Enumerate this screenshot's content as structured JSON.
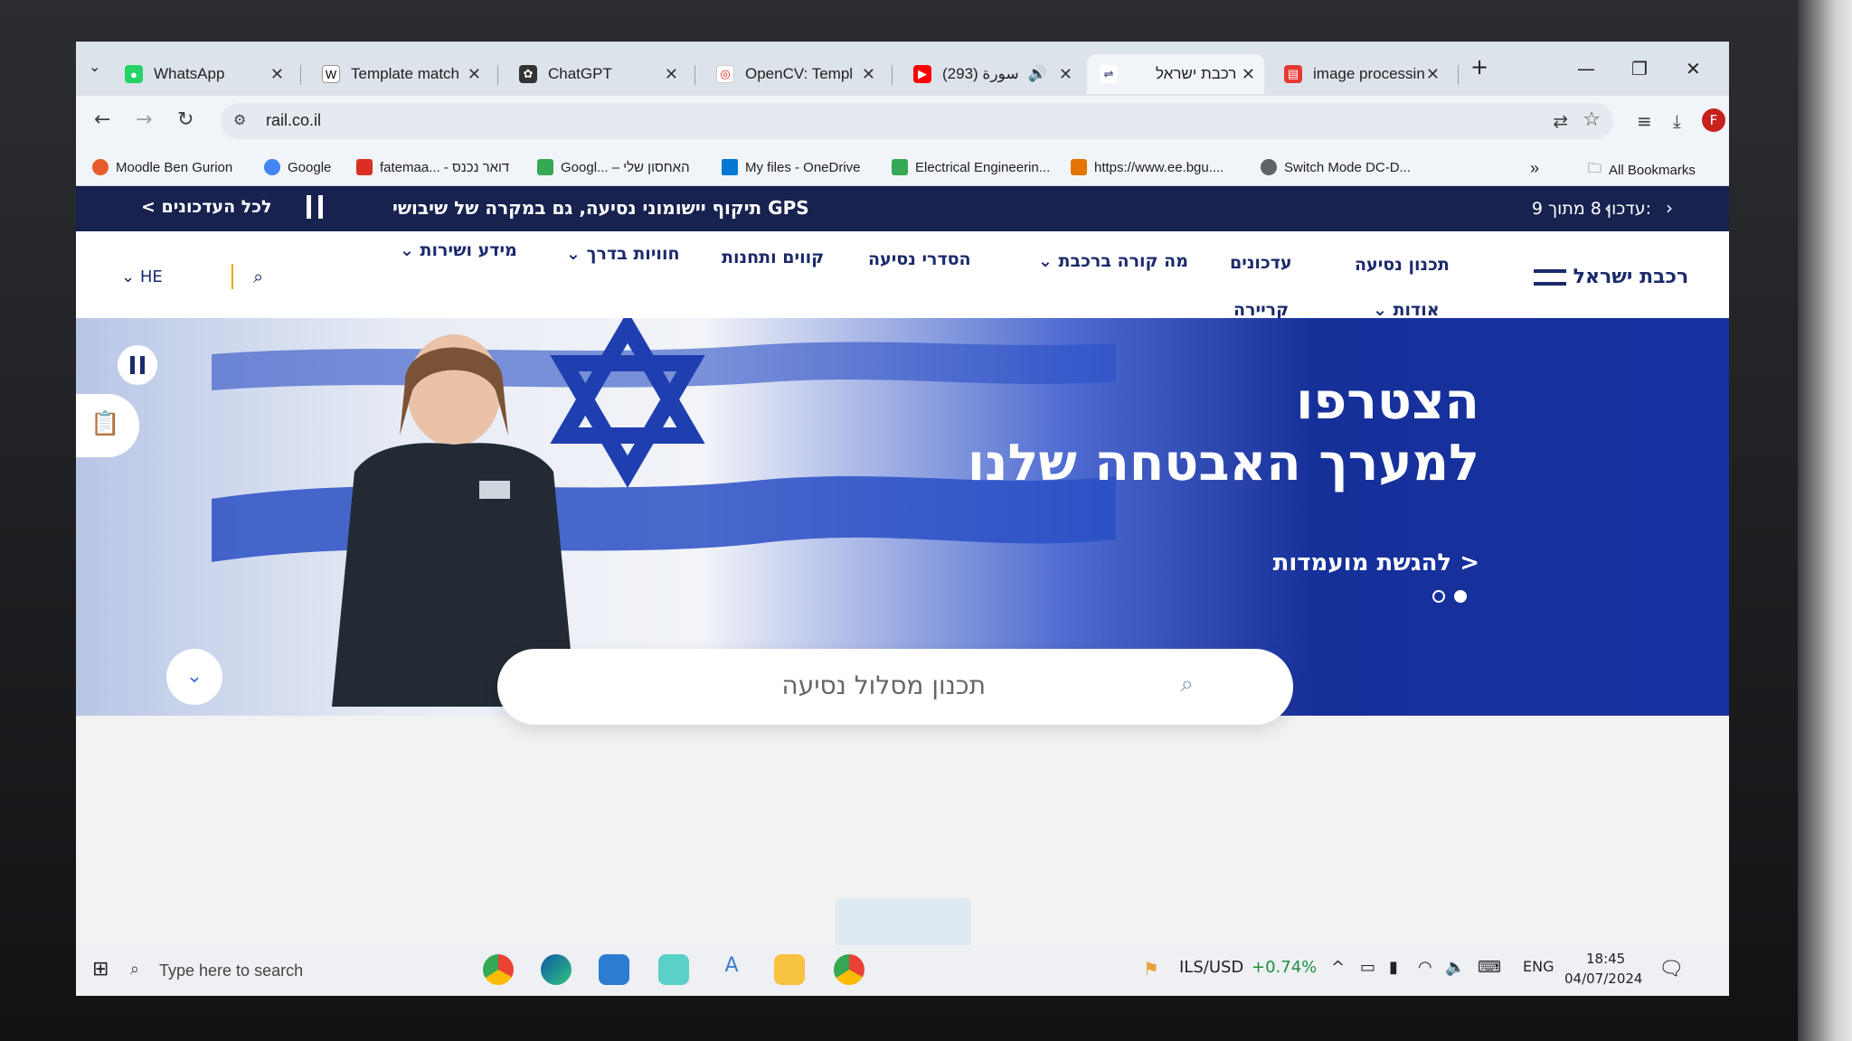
{
  "browser": {
    "tabs": [
      {
        "label": "WhatsApp",
        "icon": "whatsapp-icon",
        "close": "✕"
      },
      {
        "label": "Template match",
        "icon": "wikipedia-icon",
        "close": "✕"
      },
      {
        "label": "ChatGPT",
        "icon": "chatgpt-icon",
        "close": "✕"
      },
      {
        "label": "OpenCV: Templ",
        "icon": "opencv-icon",
        "close": "✕"
      },
      {
        "label": "سورة (293)",
        "icon": "youtube-icon",
        "close": "✕"
      },
      {
        "label": "רכבת ישראל",
        "icon": "rail-icon",
        "close": "✕"
      },
      {
        "label": "image processin",
        "icon": "pdf-icon",
        "close": "✕"
      }
    ],
    "new_tab": "+",
    "url": "rail.co.il",
    "bookmarks": [
      {
        "label": "Moodle Ben Gurion",
        "color": "#e65c2a"
      },
      {
        "label": "Google",
        "color": "#4285f4"
      },
      {
        "label": "fatemaa... - דואר נכנס",
        "color": "#d93025"
      },
      {
        "label": "Googl... – האחסון שלי",
        "color": "#34a853"
      },
      {
        "label": "My files - OneDrive",
        "color": "#0078d4"
      },
      {
        "label": "Electrical Engineerin...",
        "color": "#34a853"
      },
      {
        "label": "https://www.ee.bgu....",
        "color": "#e37400"
      },
      {
        "label": "Switch Mode DC-D...",
        "color": "#5f6368"
      }
    ],
    "overflow": "»",
    "all_bookmarks": "All Bookmarks",
    "profile_initial": "F"
  },
  "site": {
    "announcement": "תיקוף יישומוני נסיעה, גם במקרה של שיבושי GPS",
    "all_updates": "לכל העדכונים",
    "update_counter": "עדכון 8 מתוך 9:",
    "logo": "רכבת ישראל",
    "language": "HE",
    "nav_row1": [
      "תכנון נסיעה",
      "עדכונים",
      "מה קורה ברכבת",
      "הסדרי נסיעה",
      "קווים ותחנות",
      "חוויות בדרך",
      "מידע ושירות"
    ],
    "nav_row2": [
      "אודות",
      "קריירה"
    ],
    "hero": {
      "headline_1": "הצטרפו",
      "headline_2": "למערך האבטחה שלנו",
      "link": "להגשת מועמדות >"
    },
    "search_placeholder": "תכנון מסלול נסיעה"
  },
  "taskbar": {
    "search_placeholder": "Type here to search",
    "ticker_label": "ILS/USD",
    "ticker_change": "+0.74%",
    "lang": "ENG",
    "time": "18:45",
    "date": "04/07/2024"
  },
  "colors": {
    "brand_navy": "#1b2a6b",
    "announcement_bg": "#17224f",
    "hero_blue": "#1630a0",
    "ticker_green": "#1e8e3e"
  }
}
